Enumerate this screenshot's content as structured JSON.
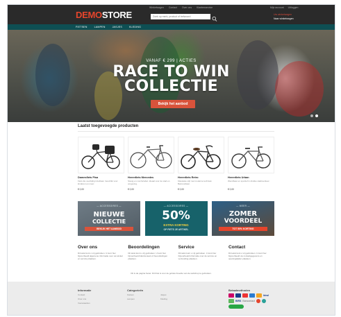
{
  "header": {
    "logo_part1": "DEMO",
    "logo_part2": "STORE",
    "top_links": [
      "Winkelwagen",
      "Contact",
      "Over ons",
      "Klantenservice"
    ],
    "search_placeholder": "Zoek op merk, product of trefwoord",
    "account_links": [
      "Mijn account",
      "Uitloggen"
    ],
    "cart_line1": "Uw winkelwagen",
    "cart_line2": "Naar winkelwagen"
  },
  "nav": {
    "items": [
      "FIETSEN",
      "LAMPEN",
      "JASJES",
      "KLEDING"
    ]
  },
  "hero": {
    "subtitle": "VANAF € 299 | ACTIES",
    "title_line1": "RACE TO WIN",
    "title_line2": "COLLECTIE",
    "button": "Bekijk het aanbod"
  },
  "products_section": {
    "title": "Laatst toegevoegde producten",
    "items": [
      {
        "name": "Damesfiets Pisa",
        "desc": "Fiets die veelzijdig inzetbaar. Geschikt voor kinderen en meer.",
        "price": "€ 0,00"
      },
      {
        "name": "Herenfiets Mercedes",
        "desc": "Stevig en comfortabel. Ideaal voor de stad en omgeving.",
        "price": "€ 0,00"
      },
      {
        "name": "Herenfiets Retro",
        "desc": "Klassieke stijl met moderne techniek. Betrouwbaar.",
        "price": "€ 0,00"
      },
      {
        "name": "Herenfiets Urban",
        "desc": "Wendbaar en sportief in drukke stadsverkeer.",
        "price": "€ 0,00"
      }
    ]
  },
  "banners": [
    {
      "small": "— ACCESSOIRES —",
      "big_line1": "NIEUWE",
      "big_line2": "COLLECTIE",
      "strip": "BEKIJK HET AANBOD"
    },
    {
      "small": "— ACCESSOIRES —",
      "big": "50%",
      "line2": "EXTRA KORTING",
      "line3": "OP FIETS 2E ARTIKEL"
    },
    {
      "small": "— MEER —",
      "big_line1": "ZOMER",
      "big_line2": "VOORDEEL",
      "strip": "TOT 50% KORTING"
    }
  ],
  "info": [
    {
      "title": "Over ons",
      "text": "Dit tekst kunt u vrij gebruiken. U kunt hier bijvoorbeeld algemene informatie over uw winkel en service plaatsen."
    },
    {
      "title": "Beoordelingen",
      "text": "Dit tekst kunt u vrij gebruiken. U kunt hier bijvoorbeeld klantreviews of beoordelingen plaatsen."
    },
    {
      "title": "Service",
      "text": "Dit tekst kunt u vrij gebruiken. U kunt hier bijvoorbeeld informatie over de service en verzending plaatsen."
    },
    {
      "title": "Contact",
      "text": "Dit tekst kunt u vrij gebruiken. U kunt hier bijvoorbeeld uw contactgegevens en openingstijden plaatsen."
    }
  ],
  "footnote": "Dit is de pagina footer. Dit blok is voor de gehele breedte van de webshop te gebruiken.",
  "footer": {
    "col1_title": "Informatie",
    "col1_links": [
      "Contact",
      "Over ons",
      "Voorwaarden"
    ],
    "col2_title": "Categorieën",
    "col2_links": [
      "Fietsen",
      "Lampen"
    ],
    "col3_links": [
      "Jasjes",
      "Kleding"
    ],
    "pay_title": "Betaalmethoden",
    "pay_text1": "Ideal",
    "pay_text2": "BIRS",
    "pay_text3": "Bancontact"
  },
  "colors": {
    "accent": "#e5452c",
    "nav": "#0e4f53",
    "button": "#d9533b",
    "topbar": "#2a2a2a"
  }
}
